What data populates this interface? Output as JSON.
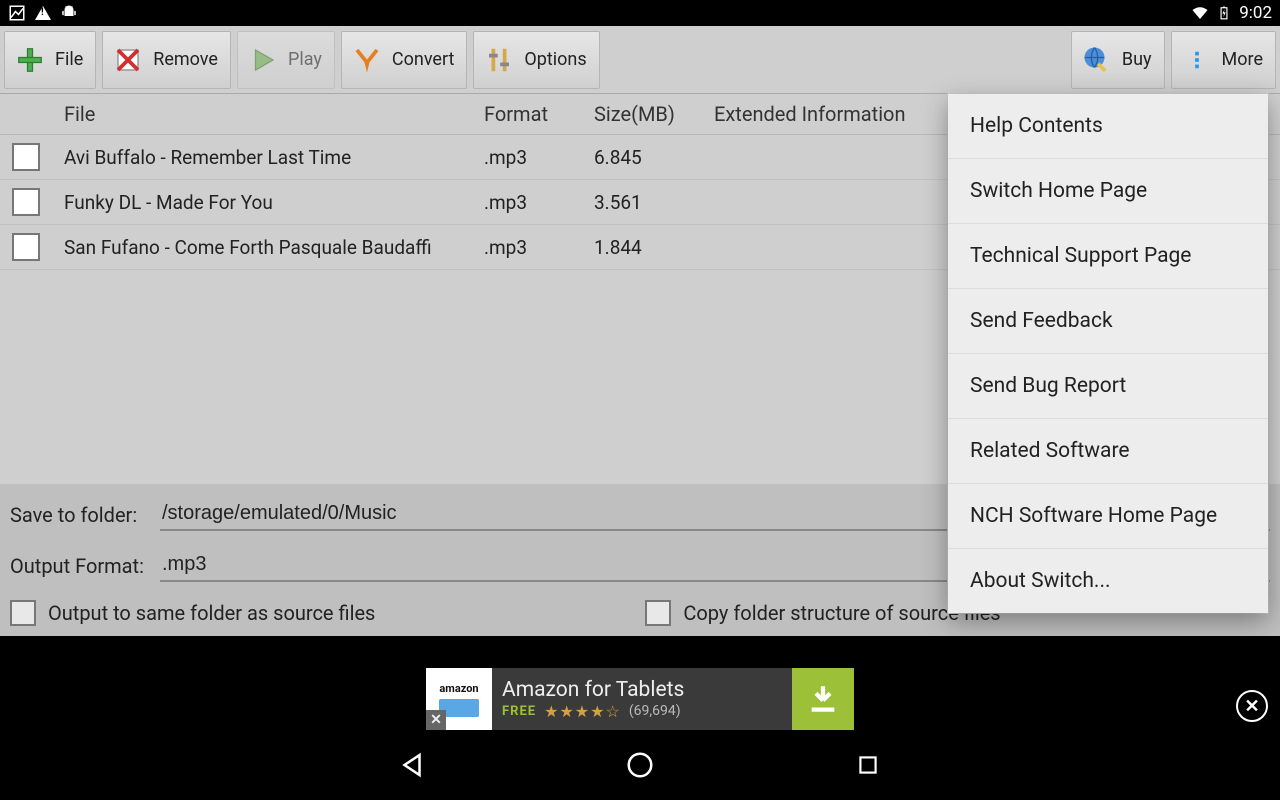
{
  "status": {
    "time": "9:02"
  },
  "toolbar": {
    "file": "File",
    "remove": "Remove",
    "play": "Play",
    "convert": "Convert",
    "options": "Options",
    "buy": "Buy",
    "more": "More"
  },
  "table": {
    "headers": {
      "file": "File",
      "format": "Format",
      "size": "Size(MB)",
      "ext": "Extended Information"
    },
    "rows": [
      {
        "file": "Avi Buffalo - Remember Last Time",
        "format": ".mp3",
        "size": "6.845"
      },
      {
        "file": "Funky DL - Made For You",
        "format": ".mp3",
        "size": "3.561"
      },
      {
        "file": "San Fufano - Come Forth Pasquale Baudaffi",
        "format": ".mp3",
        "size": "1.844"
      }
    ]
  },
  "panel": {
    "save_label": "Save to folder:",
    "save_value": "/storage/emulated/0/Music",
    "format_label": "Output Format:",
    "format_value": ".mp3",
    "same_folder": "Output to same folder as source files",
    "copy_structure": "Copy folder structure of source files"
  },
  "ad": {
    "logo": "amazon",
    "title": "Amazon for Tablets",
    "free": "FREE",
    "stars": "★★★★☆",
    "count": "(69,694)"
  },
  "menu": {
    "items": [
      "Help Contents",
      "Switch Home Page",
      "Technical Support Page",
      "Send Feedback",
      "Send Bug Report",
      "Related Software",
      "NCH Software Home Page",
      "About Switch..."
    ]
  }
}
